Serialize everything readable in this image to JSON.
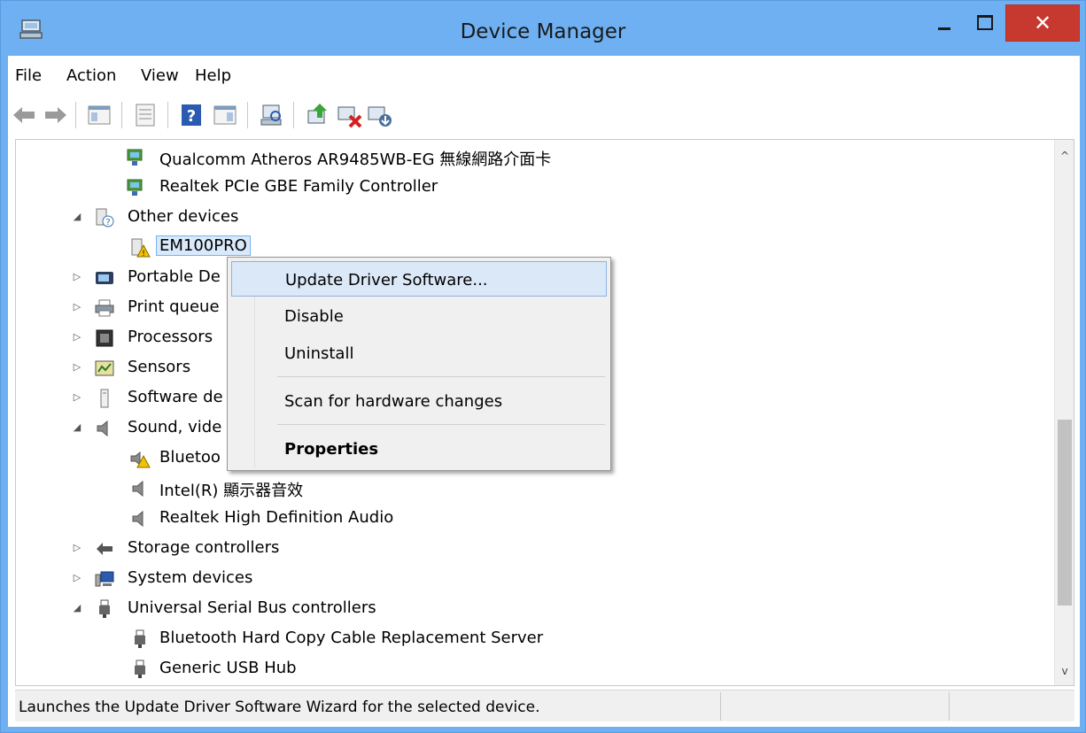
{
  "window": {
    "title": "Device Manager",
    "close_glyph": "✕",
    "icon": "device-manager-icon"
  },
  "menu": [
    "File",
    "Action",
    "View",
    "Help"
  ],
  "tree": {
    "rows": [
      {
        "label": "Qualcomm Atheros AR9485WB-EG 無線網路介面卡",
        "icon": "network-adapter-icon"
      },
      {
        "label": "Realtek PCIe GBE Family Controller",
        "icon": "network-adapter-icon"
      },
      {
        "label": "Other devices",
        "icon": "unknown-device-icon",
        "expander": "◢"
      },
      {
        "label": "EM100PRO",
        "icon": "warning-device-icon"
      },
      {
        "label": "Portable De",
        "icon": "portable-device-icon",
        "expander": "▷"
      },
      {
        "label": "Print queue",
        "icon": "printer-icon",
        "expander": "▷"
      },
      {
        "label": "Processors",
        "icon": "processor-icon",
        "expander": "▷"
      },
      {
        "label": "Sensors",
        "icon": "sensor-icon",
        "expander": "▷"
      },
      {
        "label": "Software de",
        "icon": "software-device-icon",
        "expander": "▷"
      },
      {
        "label": "Sound, vide",
        "icon": "speaker-icon",
        "expander": "◢"
      },
      {
        "label": "Bluetoo",
        "icon": "warning-speaker-icon"
      },
      {
        "label": "Intel(R) 顯示器音效",
        "icon": "speaker-icon"
      },
      {
        "label": "Realtek High Definition Audio",
        "icon": "speaker-icon"
      },
      {
        "label": "Storage controllers",
        "icon": "storage-controller-icon",
        "expander": "▷"
      },
      {
        "label": "System devices",
        "icon": "system-device-icon",
        "expander": "▷"
      },
      {
        "label": "Universal Serial Bus controllers",
        "icon": "usb-icon",
        "expander": "◢"
      },
      {
        "label": "Bluetooth Hard Copy Cable Replacement Server",
        "icon": "usb-icon"
      },
      {
        "label": "Generic USB Hub",
        "icon": "usb-icon"
      }
    ]
  },
  "context_menu": {
    "items": [
      "Update Driver Software...",
      "Disable",
      "Uninstall",
      "Scan for hardware changes",
      "Properties"
    ]
  },
  "status": {
    "text": "Launches the Update Driver Software Wizard for the selected device."
  },
  "scrollbar": {
    "up_glyph": "^",
    "down_glyph": "v"
  }
}
